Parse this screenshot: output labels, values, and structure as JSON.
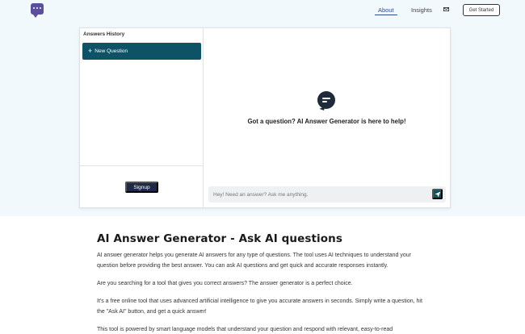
{
  "header": {
    "logo_icon": "chat-bubble-dots-icon",
    "nav": [
      {
        "label": "About",
        "active": true
      },
      {
        "label": "Insights",
        "active": false
      }
    ],
    "mail_icon": "mail-icon",
    "cta_label": "Get Started"
  },
  "sidebar": {
    "title": "Answers History",
    "new_question_label": "New Question",
    "signup_label": "Signup"
  },
  "chat": {
    "empty_icon": "chat-bubble-lines-icon",
    "empty_text": "Got a question? AI Answer Generator is here to help!",
    "input_placeholder": "Hey! Need an answer? Ask me anything.",
    "send_icon": "send-icon"
  },
  "article": {
    "title": "AI Answer Generator - Ask AI questions",
    "paragraphs": [
      "AI answer generator helps you generate AI answers for any type of questions. The tool uses AI techniques to understand your question before providing the best answer. You can ask AI questions and get quick and accurate responses instantly.",
      "Are you searching for a tool that gives you correct answers? The answer generator is a perfect choice.",
      "It's a free online tool that uses advanced artificial intelligence to give you accurate answers in seconds. Simply write a question, hit the \"Ask AI\" button, and get a quick answer!",
      "This tool is powered by smart language models that understand your question and respond with relevant, easy-to-read"
    ]
  },
  "colors": {
    "accent": "#0e5265",
    "hero_bg": "#f1f9fc",
    "signup_bg": "#1f2a4a",
    "logo": "#5b4e9e"
  }
}
